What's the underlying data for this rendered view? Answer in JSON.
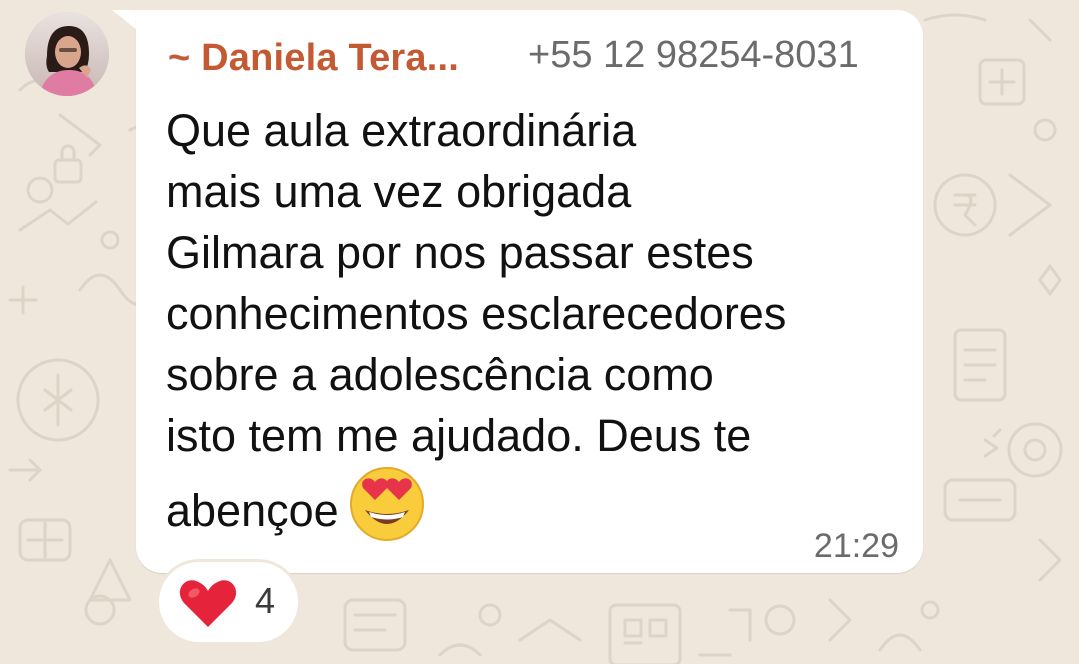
{
  "chat": {
    "background_color": "#efe7dc",
    "bubble_color": "#ffffff"
  },
  "message": {
    "sender_name": "~ Daniela Tera...",
    "sender_name_color": "#c45a33",
    "sender_phone": "+55 12 98254-8031",
    "text": "Que aula extraordinária\nmais uma vez obrigada\nGilmara por nos passar estes\nconhecimentos esclarecedores\nsobre a adolescência como\nisto tem me ajudado. Deus te\nabençoe",
    "emoji": "smiling-face-with-heart-eyes",
    "time": "21:29"
  },
  "avatar": {
    "icon": "profile-photo"
  },
  "reaction": {
    "emoji": "red-heart",
    "count": "4"
  }
}
